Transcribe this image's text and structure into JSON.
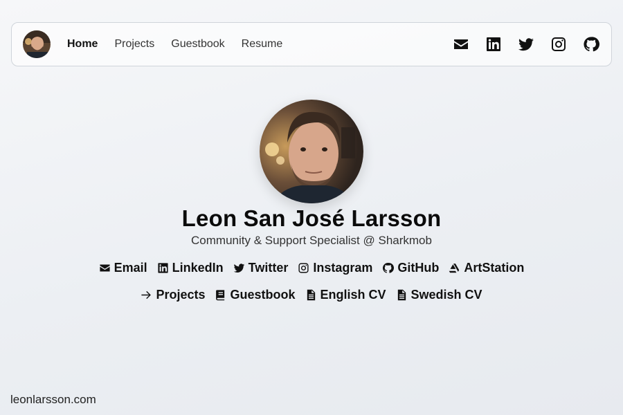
{
  "nav": {
    "links": [
      {
        "label": "Home",
        "active": true
      },
      {
        "label": "Projects",
        "active": false
      },
      {
        "label": "Guestbook",
        "active": false
      },
      {
        "label": "Resume",
        "active": false
      }
    ],
    "icons": [
      "envelope-icon",
      "linkedin-icon",
      "twitter-icon",
      "instagram-icon",
      "github-icon"
    ]
  },
  "hero": {
    "name": "Leon San José Larsson",
    "subtitle": "Community & Support Specialist @ Sharkmob",
    "social_links": [
      {
        "label": "Email",
        "icon": "envelope-icon"
      },
      {
        "label": "LinkedIn",
        "icon": "linkedin-icon"
      },
      {
        "label": "Twitter",
        "icon": "twitter-icon"
      },
      {
        "label": "Instagram",
        "icon": "instagram-icon"
      },
      {
        "label": "GitHub",
        "icon": "github-icon"
      },
      {
        "label": "ArtStation",
        "icon": "artstation-icon"
      }
    ],
    "page_links": [
      {
        "label": "Projects",
        "icon": "arrow-right-icon"
      },
      {
        "label": "Guestbook",
        "icon": "book-icon"
      },
      {
        "label": "English CV",
        "icon": "file-icon"
      },
      {
        "label": "Swedish CV",
        "icon": "file-icon"
      }
    ]
  },
  "footer": {
    "domain": "leonlarsson.com"
  },
  "colors": {
    "text": "#111111",
    "border": "#cfd4da",
    "background": "#eceff3"
  }
}
